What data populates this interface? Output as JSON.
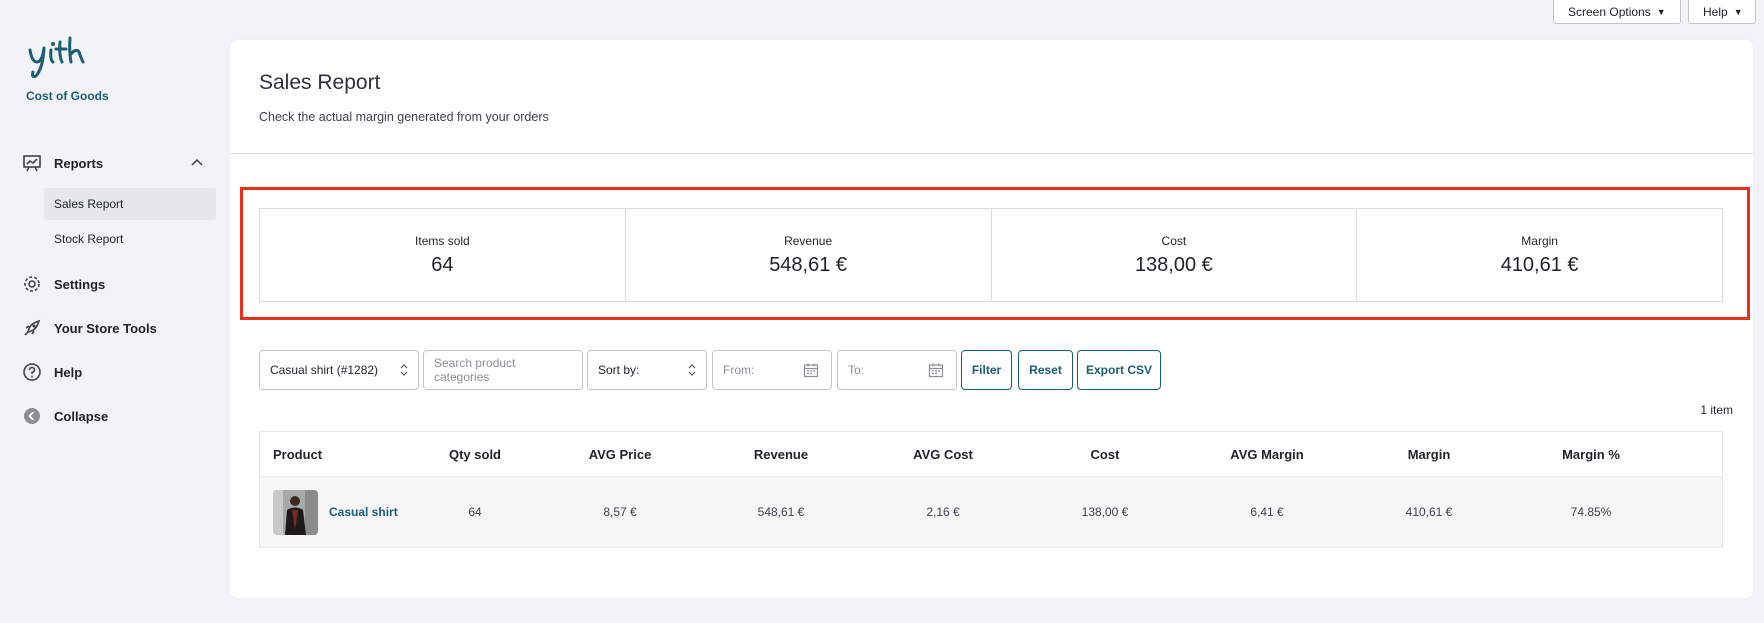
{
  "sidebar": {
    "plugin_name": "Cost of Goods",
    "reports_label": "Reports",
    "sub_items": [
      "Sales Report",
      "Stock Report"
    ],
    "settings_label": "Settings",
    "store_tools_label": "Your Store Tools",
    "help_label": "Help",
    "collapse_label": "Collapse"
  },
  "top_buttons": {
    "screen_options": "Screen Options",
    "help": "Help"
  },
  "page": {
    "title": "Sales Report",
    "subtitle": "Check the actual margin generated from your orders"
  },
  "stats": [
    {
      "label": "Items sold",
      "value": "64"
    },
    {
      "label": "Revenue",
      "value": "548,61 €"
    },
    {
      "label": "Cost",
      "value": "138,00 €"
    },
    {
      "label": "Margin",
      "value": "410,61 €"
    }
  ],
  "filters": {
    "product_select": "Casual shirt (#1282)",
    "category_placeholder": "Search product categories",
    "sort_by": "Sort by:",
    "from_placeholder": "From:",
    "to_placeholder": "To:",
    "filter_label": "Filter",
    "reset_label": "Reset",
    "export_label": "Export CSV"
  },
  "item_count": "1 item",
  "table": {
    "headers": [
      "Product",
      "Qty sold",
      "AVG Price",
      "Revenue",
      "AVG Cost",
      "Cost",
      "AVG Margin",
      "Margin",
      "Margin %"
    ],
    "rows": [
      {
        "product": "Casual shirt",
        "qty_sold": "64",
        "avg_price": "8,57 €",
        "revenue": "548,61 €",
        "avg_cost": "2,16 €",
        "cost": "138,00 €",
        "avg_margin": "6,41 €",
        "margin": "410,61 €",
        "margin_pct": "74.85%"
      }
    ]
  },
  "colors": {
    "accent": "#1b5d73",
    "highlight": "#e8301c",
    "background": "#f1f3f7"
  }
}
